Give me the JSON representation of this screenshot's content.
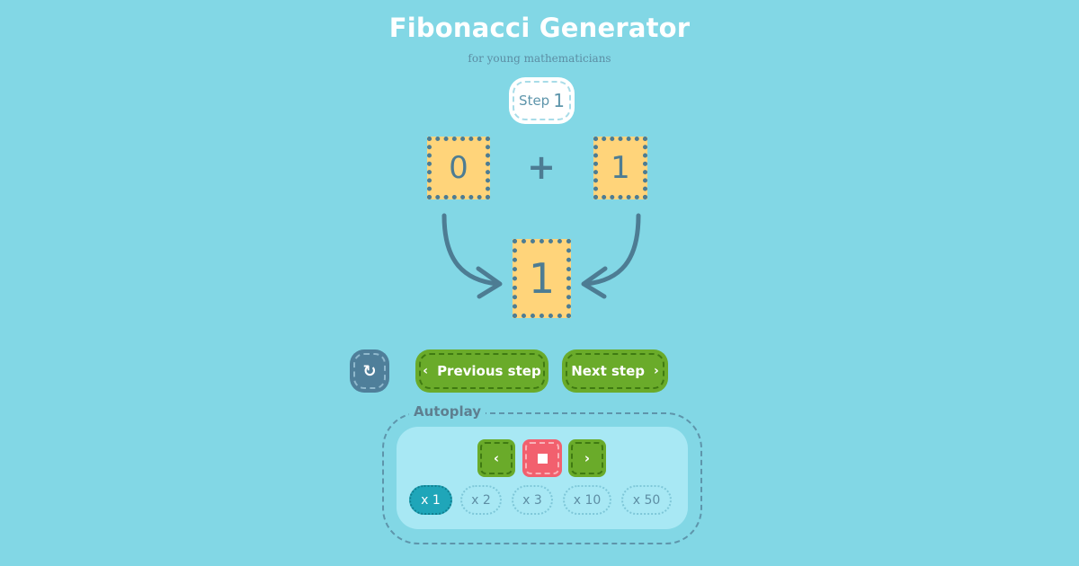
{
  "header": {
    "title": "Fibonacci Generator",
    "subtitle": "for young mathematicians"
  },
  "step": {
    "label": "Step",
    "number": "1"
  },
  "equation": {
    "left": "0",
    "operator": "+",
    "right": "1",
    "result": "1"
  },
  "controls": {
    "reset_icon": "↻",
    "prev_chevron": "‹",
    "prev_label": "Previous step",
    "next_label": "Next step",
    "next_chevron": "›"
  },
  "autoplay": {
    "label": "Autoplay",
    "back_icon": "‹",
    "forward_icon": "›",
    "speeds": [
      "x 1",
      "x 2",
      "x 3",
      "x 10",
      "x 50"
    ],
    "selected_speed": "x 1"
  },
  "colors": {
    "background": "#82d7e5",
    "tile": "#ffd47a",
    "green_button": "#6aab2a",
    "stop_button": "#f2606e",
    "active_speed": "#1fa6b9",
    "reset_button": "#4f7f9a"
  },
  "icons": {
    "reset": "reset-icon",
    "prev": "chevron-left-icon",
    "next": "chevron-right-icon",
    "stop": "stop-icon"
  }
}
